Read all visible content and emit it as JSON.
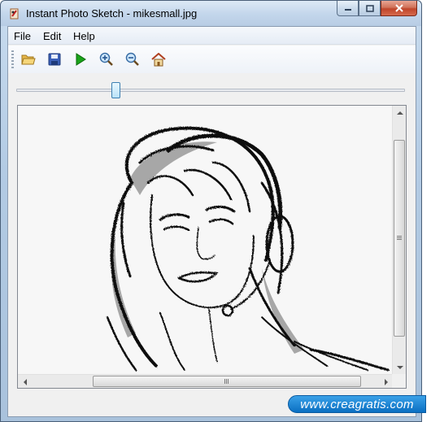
{
  "window": {
    "title": "Instant Photo Sketch - mikesmall.jpg"
  },
  "menu": {
    "items": [
      "File",
      "Edit",
      "Help"
    ]
  },
  "toolbar": {
    "buttons": [
      {
        "name": "open-icon"
      },
      {
        "name": "save-icon"
      },
      {
        "name": "play-icon"
      },
      {
        "name": "zoom-in-icon"
      },
      {
        "name": "zoom-out-icon"
      },
      {
        "name": "home-icon"
      }
    ]
  },
  "slider": {
    "value_fraction": 0.25
  },
  "image": {
    "description_alt": "sketch"
  },
  "watermark": {
    "text": "www.creagratis.com"
  },
  "colors": {
    "accent": "#3c7fb1",
    "watermark": "#0a6fc2",
    "close": "#c0452a"
  }
}
